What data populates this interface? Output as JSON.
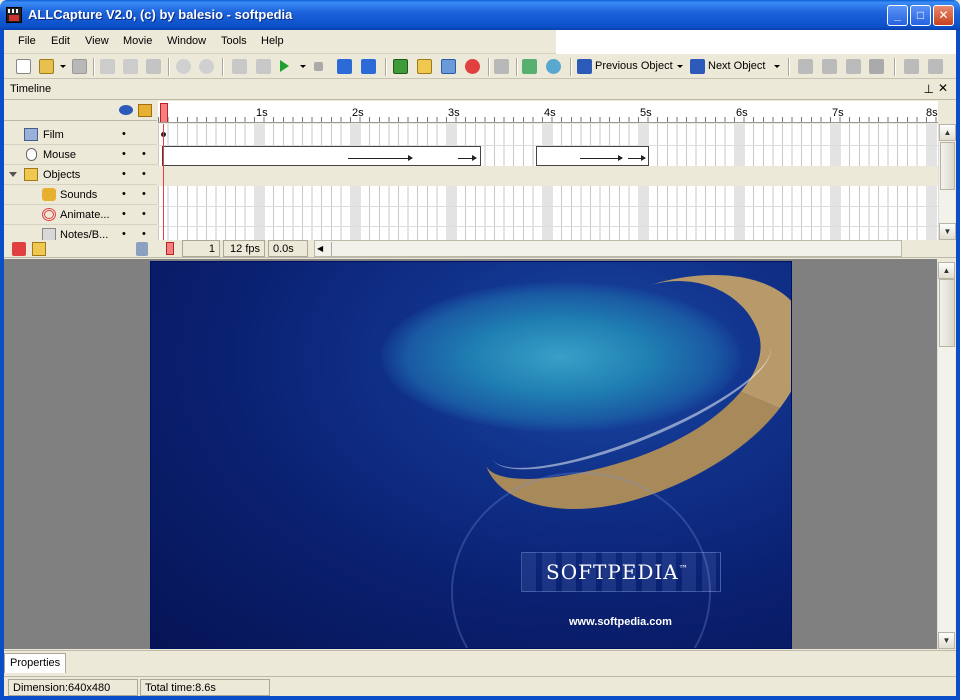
{
  "window": {
    "title": "ALLCapture V2.0, (c) by balesio - softpedia"
  },
  "menu": [
    "File",
    "Edit",
    "View",
    "Movie",
    "Window",
    "Tools",
    "Help"
  ],
  "toolbar": {
    "previous_object_label": "Previous Object",
    "next_object_label": "Next Object",
    "icons": [
      "new-icon",
      "open-icon",
      "save-icon",
      "cut-icon",
      "copy-icon",
      "paste-icon",
      "undo-icon",
      "redo-icon",
      "go-start-icon",
      "rewind-icon",
      "play-icon",
      "stop-icon",
      "fast-forward-icon",
      "go-end-icon",
      "image-icon",
      "folder-icon",
      "import-icon",
      "record-icon",
      "sound-icon",
      "fx-icon"
    ]
  },
  "timeline": {
    "title": "Timeline",
    "tracks": [
      {
        "label": "Film"
      },
      {
        "label": "Mouse"
      },
      {
        "label": "Objects"
      },
      {
        "label": "Sounds"
      },
      {
        "label": "Animate..."
      },
      {
        "label": "Notes/B..."
      }
    ],
    "dot": "•",
    "ruler_labels": [
      "1s",
      "2s",
      "3s",
      "4s",
      "5s",
      "6s",
      "7s",
      "8s"
    ],
    "frame": "1",
    "fps": "12 fps",
    "time": "0.0s"
  },
  "preview": {
    "logo_text": "SOFTPEDIA",
    "tm": "™",
    "url": "www.softpedia.com"
  },
  "properties_tab": "Properties",
  "status": {
    "dimension": "Dimension:640x480",
    "total_time": "Total time:8.6s"
  }
}
